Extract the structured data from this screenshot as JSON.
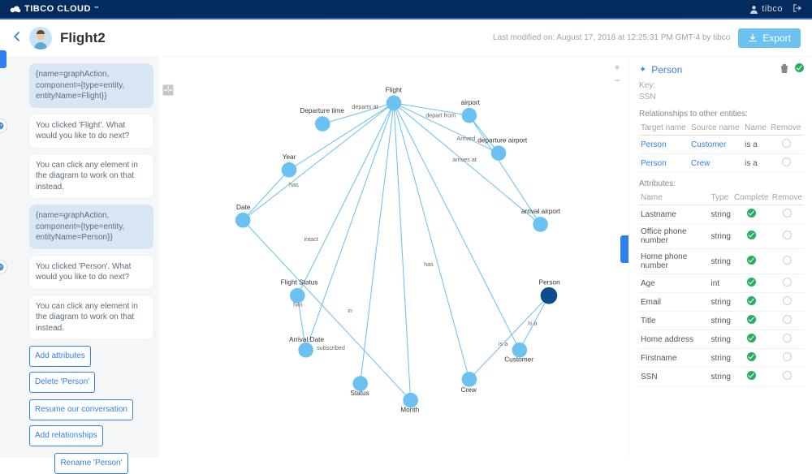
{
  "brand": "TIBCO CLOUD",
  "user": {
    "name": "tibco"
  },
  "header": {
    "title": "Flight2",
    "last_modified": "Last modified on: August 17, 2018 at 12:25:31 PM GMT-4 by tibco",
    "export": "Export"
  },
  "chat": {
    "m0": "{name=graphAction, component={type=entity, entityName=Flight}}",
    "m1": "You clicked 'Flight'. What would you like to do next?",
    "m2": "You can click any element in the diagram to work on that instead.",
    "m3": "{name=graphAction, component={type=entity, entityName=Person}}",
    "m4": "You clicked 'Person'. What would you like to do next?",
    "m5": "You can click any element in the diagram to work on that instead."
  },
  "actions": {
    "b0": "Add attributes",
    "b1": "Delete 'Person'",
    "b2": "Resume our conversation",
    "b3": "Add relationships",
    "b4": "Rename 'Person'"
  },
  "graph": {
    "nodes": {
      "flight": "Flight",
      "departure_time": "Departure time",
      "year": "Year",
      "date": "Date",
      "flight_status": "Flight Status",
      "arrival_date": "Arrival Date",
      "status": "Status",
      "month": "Month",
      "crew": "Crew",
      "customer": "Customer",
      "person": "Person",
      "arrival_airport": "arrival airport",
      "airport": "airport",
      "departure_airport": "departure airport"
    },
    "edges": {
      "departs_at": "departs at",
      "depart_from": "depart from",
      "arrives_at": "arrives at",
      "has": "has",
      "intact": "intact",
      "is_a": "is a",
      "in": "in",
      "subscribed": "subscribed",
      "arrived": "Arrived"
    }
  },
  "panel": {
    "entity": "Person",
    "key_label": "Key:",
    "key_value": "SSN",
    "rel_title": "Relationships to other entities:",
    "rel_headers": {
      "target": "Target name",
      "source": "Source name",
      "name": "Name",
      "remove": "Remove"
    },
    "rels": [
      {
        "target": "Person",
        "source": "Customer",
        "name": "is a"
      },
      {
        "target": "Person",
        "source": "Crew",
        "name": "is a"
      }
    ],
    "attr_title": "Attributes:",
    "attr_headers": {
      "name": "Name",
      "type": "Type",
      "complete": "Complete",
      "remove": "Remove"
    },
    "attrs": [
      {
        "name": "Lastname",
        "type": "string"
      },
      {
        "name": "Office phone number",
        "type": "string"
      },
      {
        "name": "Home phone number",
        "type": "string"
      },
      {
        "name": "Age",
        "type": "int"
      },
      {
        "name": "Email",
        "type": "string"
      },
      {
        "name": "Title",
        "type": "string"
      },
      {
        "name": "Home address",
        "type": "string"
      },
      {
        "name": "Firstname",
        "type": "string"
      },
      {
        "name": "SSN",
        "type": "string"
      }
    ]
  }
}
